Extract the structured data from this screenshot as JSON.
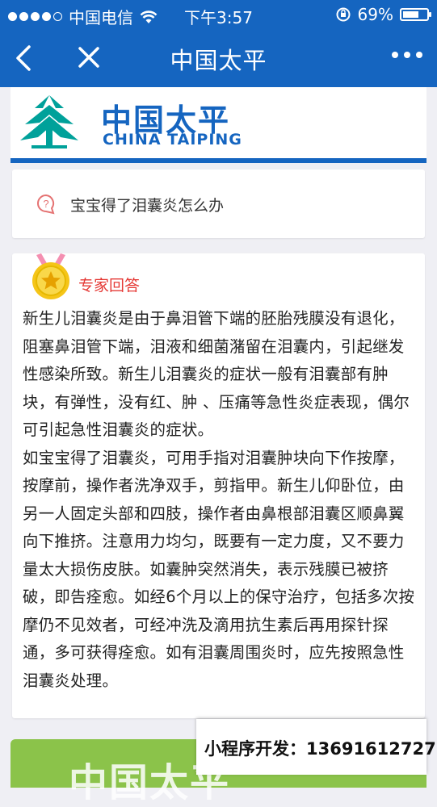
{
  "status_bar": {
    "carrier": "中国电信",
    "time": "下午3:57",
    "battery_percent": "69%",
    "battery_level": 0.69,
    "signal_bars": 4,
    "icons": [
      "signal-icon",
      "wifi-icon",
      "orientation-lock-icon",
      "battery-icon"
    ]
  },
  "nav": {
    "title": "中国太平",
    "icons": [
      "back-icon",
      "close-icon",
      "more-icon"
    ],
    "bar_color": "#1565c0"
  },
  "logo": {
    "name_cn": "中国太平",
    "name_en": "CHINA TAIPING",
    "brand_color": "#1565c0",
    "emblem_color": "#00a19a"
  },
  "question": {
    "icon": "question-bubble-icon",
    "text": "宝宝得了泪囊炎怎么办"
  },
  "answer": {
    "badge_icon": "gold-medal-star-icon",
    "label": "专家回答",
    "label_color": "#e53935",
    "paragraphs": [
      "新生儿泪囊炎是由于鼻泪管下端的胚胎残膜没有退化，阻塞鼻泪管下端，泪液和细菌潴留在泪囊内，引起继发性感染所致。新生儿泪囊炎的症状一般有泪囊部有肿块，有弹性，没有红、肿 、压痛等急性炎症表现，偶尔可引起急性泪囊炎的症状。",
      "如宝宝得了泪囊炎，可用手指对泪囊肿块向下作按摩，按摩前，操作者洗净双手，剪指甲。新生儿仰卧位，由另一人固定头部和四肢，操作者由鼻根部泪囊区顺鼻翼向下推挤。注意用力均匀，既要有一定力度，又不要力量太大损伤皮肤。如囊肿突然消失，表示残膜已被挤破，即告痊愈。如经6个月以上的保守治疗，包括多次按摩仍不见效者，可经冲洗及滴用抗生素后再用探针探通，多可获得痊愈。如有泪囊周围炎时，应先按照急性泪囊炎处理。"
    ]
  },
  "banner": {
    "partial_text": "中国太平",
    "color": "#8bc34a"
  },
  "promo": {
    "text": "小程序开发：13691612727"
  }
}
